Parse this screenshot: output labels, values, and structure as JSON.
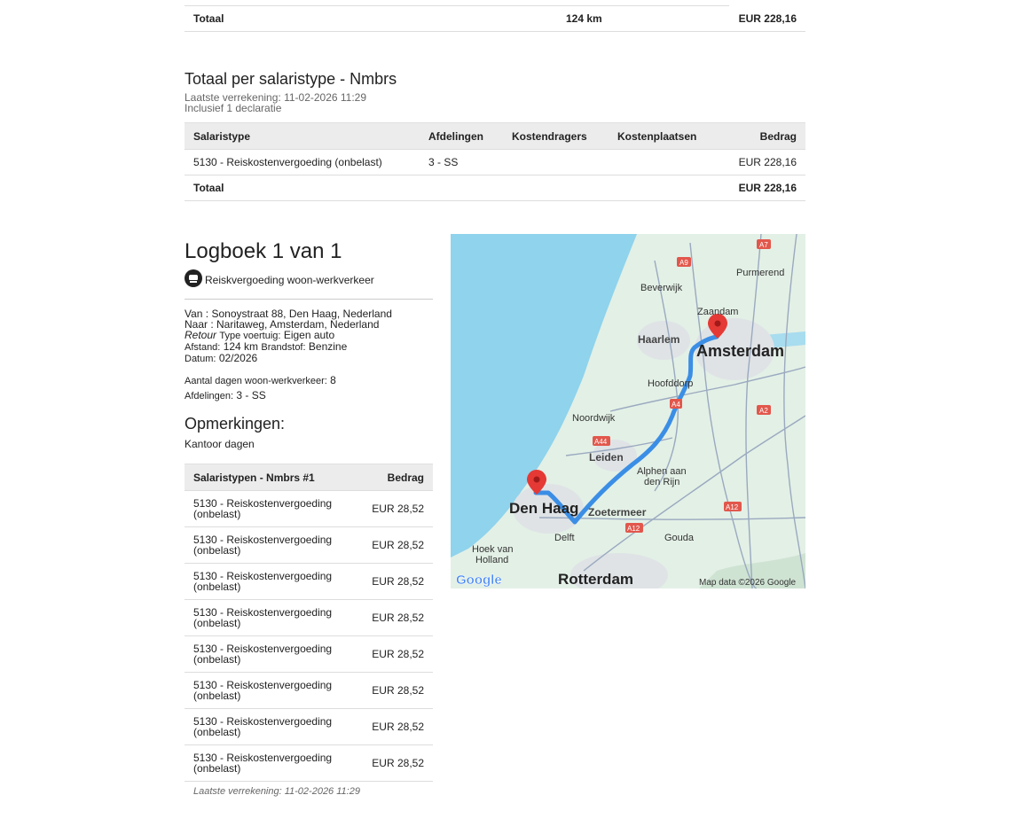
{
  "top_total": {
    "label": "Totaal",
    "distance": "124 km",
    "amount": "EUR 228,16"
  },
  "salary_section": {
    "title": "Totaal per salaristype - Nmbrs",
    "last_settlement": "Laatste verrekening: 11-02-2026 11:29",
    "inclusive": "Inclusief 1 declaratie",
    "headers": [
      "Salaristype",
      "Afdelingen",
      "Kostendragers",
      "Kostenplaatsen",
      "Bedrag"
    ],
    "rows": [
      {
        "type": "5130 - Reiskostenvergoeding (onbelast)",
        "dept": "3 - SS",
        "carriers": "",
        "places": "",
        "amount": "EUR 228,16"
      }
    ],
    "total_label": "Totaal",
    "total_amount": "EUR 228,16"
  },
  "logbook": {
    "title": "Logboek 1 van 1",
    "type_label": "Reiskvergoeding woon-werkverkeer",
    "icon": "car-icon",
    "van": "Van : Sonoystraat 88, Den Haag, Nederland",
    "naar": "Naar : Naritaweg, Amsterdam, Nederland",
    "retour": "Retour",
    "vehicle_label": "Type voertuig:",
    "vehicle": "Eigen auto",
    "distance_label": "Afstand:",
    "distance": "124 km",
    "fuel_label": "Brandstof:",
    "fuel": "Benzine",
    "date_label": "Datum:",
    "date": "02/2026",
    "days_label": "Aantal dagen woon-werkverkeer:",
    "days": "8",
    "dept_label": "Afdelingen:",
    "dept": "3 - SS",
    "remarks_title": "Opmerkingen:",
    "remarks": "Kantoor dagen",
    "table_headers": [
      "Salaristypen - Nmbrs #1",
      "Bedrag"
    ],
    "rows": [
      {
        "type": "5130 - Reiskostenvergoeding (onbelast)",
        "amount": "EUR 28,52"
      },
      {
        "type": "5130 - Reiskostenvergoeding (onbelast)",
        "amount": "EUR 28,52"
      },
      {
        "type": "5130 - Reiskostenvergoeding (onbelast)",
        "amount": "EUR 28,52"
      },
      {
        "type": "5130 - Reiskostenvergoeding (onbelast)",
        "amount": "EUR 28,52"
      },
      {
        "type": "5130 - Reiskostenvergoeding (onbelast)",
        "amount": "EUR 28,52"
      },
      {
        "type": "5130 - Reiskostenvergoeding (onbelast)",
        "amount": "EUR 28,52"
      },
      {
        "type": "5130 - Reiskostenvergoeding (onbelast)",
        "amount": "EUR 28,52"
      },
      {
        "type": "5130 - Reiskostenvergoeding (onbelast)",
        "amount": "EUR 28,52"
      }
    ],
    "footnote": "Laatste verrekening: 11-02-2026 11:29"
  },
  "map": {
    "cities": {
      "amsterdam": "Amsterdam",
      "den_haag": "Den Haag",
      "rotterdam": "Rotterdam",
      "haarlem": "Haarlem",
      "zaandam": "Zaandam",
      "purmerend": "Purmerend",
      "beverwijk": "Beverwijk",
      "hoofddorp": "Hoofddorp",
      "noordwijk": "Noordwijk",
      "leiden": "Leiden",
      "alphen": "Alphen aan",
      "alphen2": "den Rijn",
      "zoetermeer": "Zoetermeer",
      "delft": "Delft",
      "gouda": "Gouda",
      "hoek": "Hoek van",
      "hoek2": "Holland"
    },
    "roads": {
      "a7": "A7",
      "a9": "A9",
      "a4": "A4",
      "a44": "A44",
      "a2": "A2",
      "a12a": "A12",
      "a12b": "A12"
    },
    "logo": "Google",
    "attribution": "Map data ©2026 Google",
    "colors": {
      "sea": "#8fd3ec",
      "land": "#e3f0e6",
      "route": "#3b8ee5",
      "pin": "#e53935"
    }
  }
}
